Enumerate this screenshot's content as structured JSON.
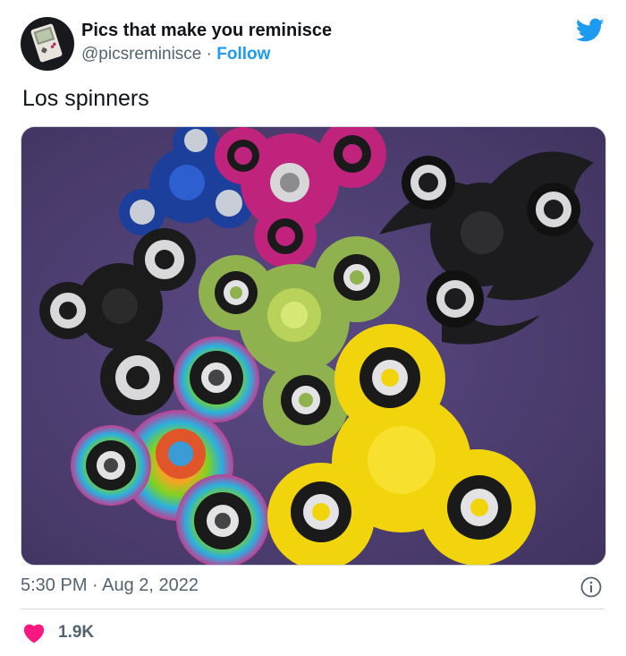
{
  "author": {
    "display_name": "Pics that make you reminisce",
    "handle": "@picsreminisce",
    "separator": " · ",
    "follow_label": "Follow"
  },
  "tweet": {
    "text": "Los spinners",
    "timestamp": "5:30 PM · Aug 2, 2022",
    "likes": "1.9K"
  },
  "icons": {
    "brand": "twitter-bird-icon",
    "avatar": "gameboy-icon",
    "info": "info-icon",
    "like": "heart-icon"
  },
  "colors": {
    "accent": "#1d9bf0",
    "heart": "#f91880",
    "secondary_text": "#536471",
    "primary_text": "#0f1419"
  }
}
